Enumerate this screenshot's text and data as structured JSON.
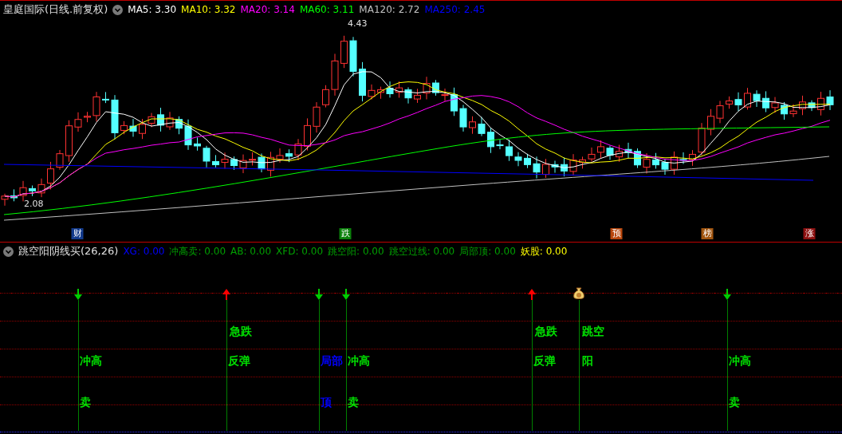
{
  "header": {
    "title": "皇庭国际(日线.前复权)",
    "indicators": [
      {
        "label": "MA5: 3.30",
        "color": "#ffffff"
      },
      {
        "label": "MA10: 3.32",
        "color": "#ffff00"
      },
      {
        "label": "MA20: 3.14",
        "color": "#ff00ff"
      },
      {
        "label": "MA60: 3.11",
        "color": "#00ff00"
      },
      {
        "label": "MA120: 2.72",
        "color": "#c0c0c0"
      },
      {
        "label": "MA250: 2.45",
        "color": "#0000ff"
      }
    ]
  },
  "chart": {
    "high_label": "4.43",
    "low_label": "2.08",
    "events": [
      {
        "label": "财",
        "color": "#123a8c"
      },
      {
        "label": "跌",
        "color": "#0a800a"
      },
      {
        "label": "预",
        "color": "#b8460c"
      },
      {
        "label": "榜",
        "color": "#a0540e"
      },
      {
        "label": "涨",
        "color": "#8c1010"
      }
    ]
  },
  "indicator_panel": {
    "title": "跳空阳阴线买(26,26)",
    "values": [
      {
        "label": "XG: 0.00",
        "color": "#0000ff"
      },
      {
        "label": "冲高卖: 0.00",
        "color": "#00a000"
      },
      {
        "label": "AB: 0.00",
        "color": "#00a000"
      },
      {
        "label": "XFD: 0.00",
        "color": "#00a000"
      },
      {
        "label": "跳空阳: 0.00",
        "color": "#00a000"
      },
      {
        "label": "跳空过线: 0.00",
        "color": "#00a000"
      },
      {
        "label": "局部顶: 0.00",
        "color": "#00a000"
      },
      {
        "label": "妖股: 0.00",
        "color": "#ffff00"
      }
    ],
    "signals": [
      {
        "kind": "sell-arrow",
        "color": "#00e000",
        "middle": "冲高",
        "lower": "卖"
      },
      {
        "kind": "buy-arrow",
        "color": "#00e000",
        "upper": "急跌",
        "middle": "反弹"
      },
      {
        "kind": "sell-arrow",
        "color": "#0000ff",
        "middle": "局部",
        "lower": "顶"
      },
      {
        "kind": "sell-arrow",
        "color": "#00e000",
        "middle": "冲高",
        "lower": "卖"
      },
      {
        "kind": "buy-arrow",
        "color": "#00e000",
        "upper": "急跌",
        "middle": "反弹"
      },
      {
        "kind": "money-bag",
        "color": "#00e000",
        "upper": "跳空",
        "middle": "阳"
      },
      {
        "kind": "sell-arrow",
        "color": "#00e000",
        "middle": "冲高",
        "lower": "卖"
      }
    ]
  }
}
